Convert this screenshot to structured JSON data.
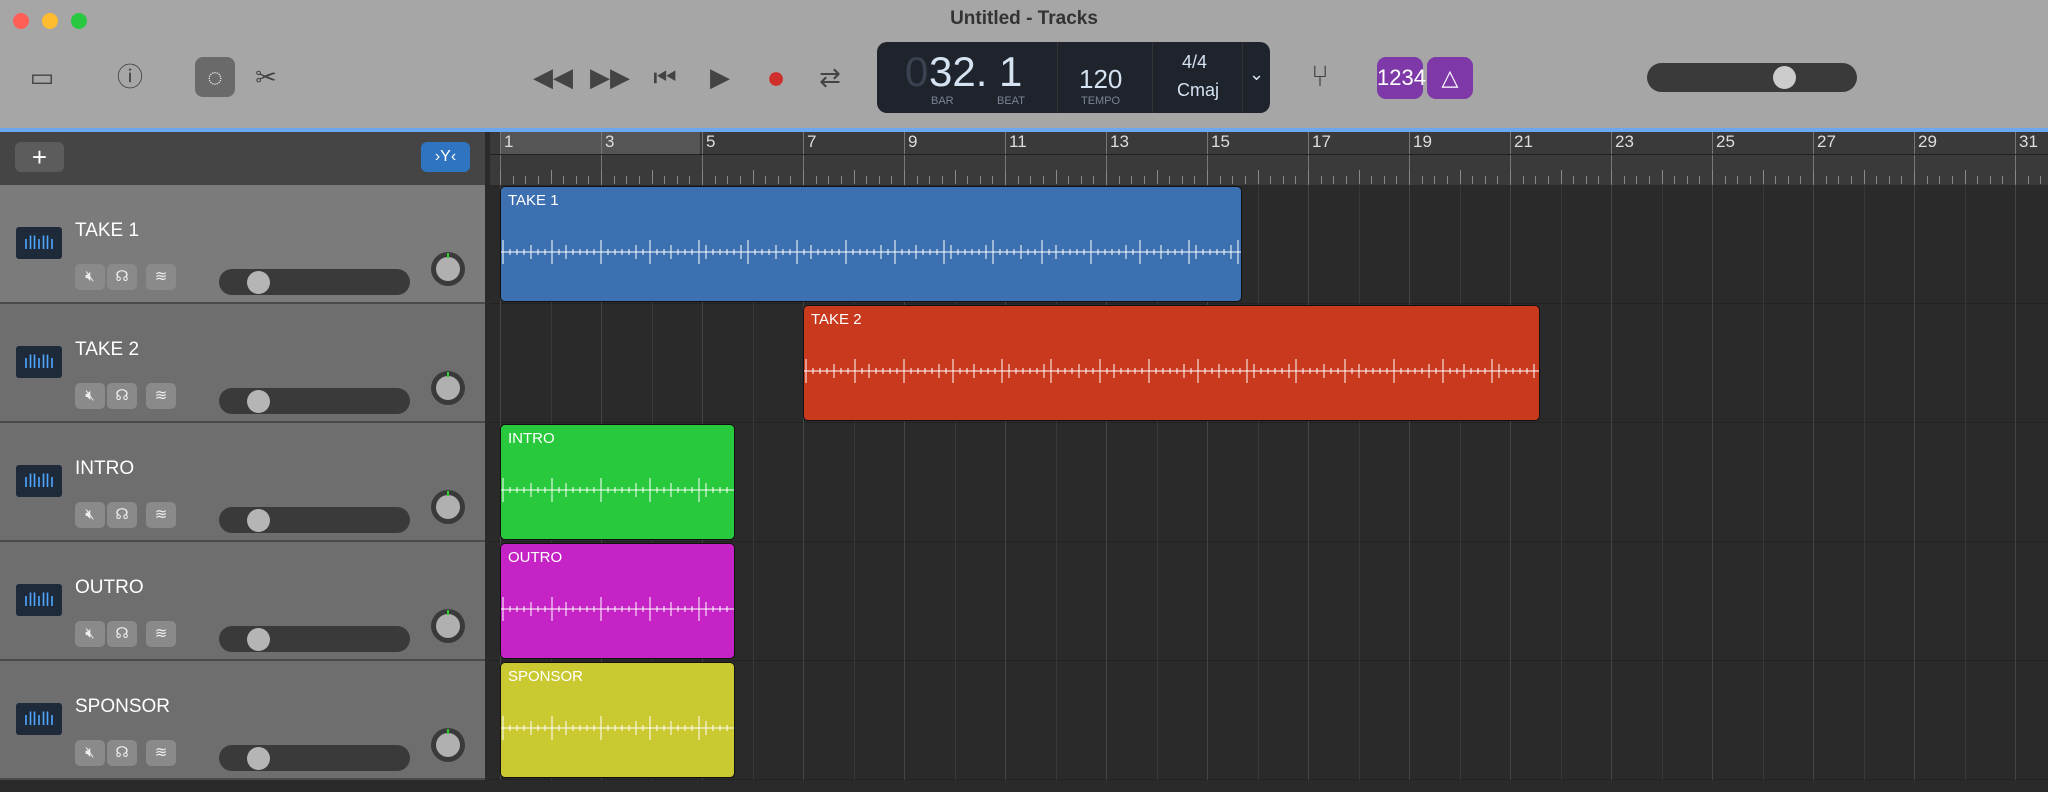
{
  "window": {
    "title": "Untitled - Tracks"
  },
  "toolbar": {
    "lcd": {
      "bar_lead": "0",
      "position": "32. 1",
      "bar_label": "BAR",
      "beat_label": "BEAT",
      "tempo": "120",
      "tempo_label": "TEMPO",
      "time_signature": "4/4",
      "key": "Cmaj"
    },
    "count_in": "1234",
    "master_volume": 0.7
  },
  "ruler": {
    "bars": [
      "1",
      "3",
      "5",
      "7",
      "9",
      "11",
      "13",
      "15",
      "17",
      "19",
      "21",
      "23",
      "25",
      "27",
      "29",
      "31"
    ]
  },
  "tracks": [
    {
      "name": "TAKE 1",
      "color": "#3d70b0",
      "start": 1,
      "end": 15.7,
      "volume": 0.2,
      "selected": true
    },
    {
      "name": "TAKE 2",
      "color": "#c8391e",
      "start": 7,
      "end": 21.6,
      "volume": 0.2
    },
    {
      "name": "INTRO",
      "color": "#28c93c",
      "start": 1,
      "end": 5.65,
      "volume": 0.2
    },
    {
      "name": "OUTRO",
      "color": "#c523c5",
      "start": 1,
      "end": 5.65,
      "volume": 0.2
    },
    {
      "name": "SPONSOR",
      "color": "#cbc932",
      "start": 1,
      "end": 5.65,
      "volume": 0.2
    }
  ]
}
